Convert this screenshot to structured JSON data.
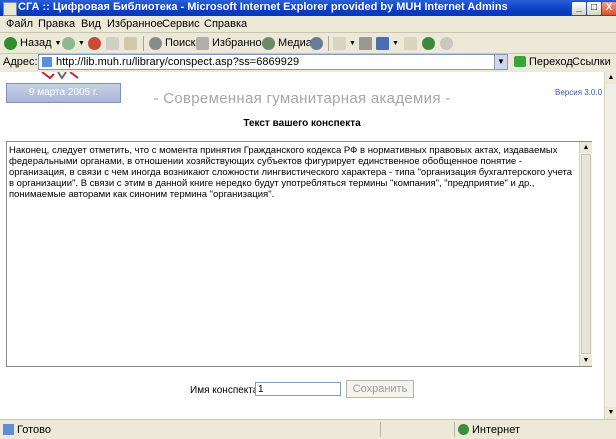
{
  "window": {
    "title": "СГА :: Цифровая Библиотека - Microsoft Internet Explorer provided by MUH Internet Admins",
    "min_label": "_",
    "max_label": "□",
    "close_label": "X"
  },
  "menu": [
    "Файл",
    "Правка",
    "Вид",
    "Избранное",
    "Сервис",
    "Справка"
  ],
  "toolbar": {
    "back": "Назад",
    "search": "Поиск",
    "favorites": "Избранное",
    "media": "Медиа"
  },
  "address": {
    "label": "Адрес:",
    "url": "http://lib.muh.ru/library/conspect.asp?ss=6869929",
    "go": "Переход",
    "links": "Ссылки"
  },
  "page": {
    "date": "9 марта 2005 г.",
    "academy": "- Современная гуманитарная академия -",
    "version": "Версия 3.0.0",
    "heading": "Текст вашего конспекта",
    "conspect_text": "Наконец, следует отметить, что с момента принятия Гражданского кодекса РФ в нормативных правовых актах, издаваемых федеральными органами, в отношении хозяйствующих субъектов фигурирует единственное обобщенное понятие - организация, в связи с чем иногда возникают сложности лингвистического характера - типа \"организация бухгалтерского учета в организации\". В связи с этим в данной книге нередко будут употребляться термины \"компания\", \"предприятие\" и др., понимаемые авторами как синоним термина \"организация\".",
    "name_label": "Имя конспекта",
    "name_value": "1",
    "save_label": "Сохранить"
  },
  "status": {
    "text": "Готово",
    "zone": "Интернет"
  },
  "colors": {
    "titlebar": "#0a3fc2",
    "chrome": "#ece9d8",
    "academy_text": "#a6a6a6",
    "date_box": "#aab6d8"
  }
}
